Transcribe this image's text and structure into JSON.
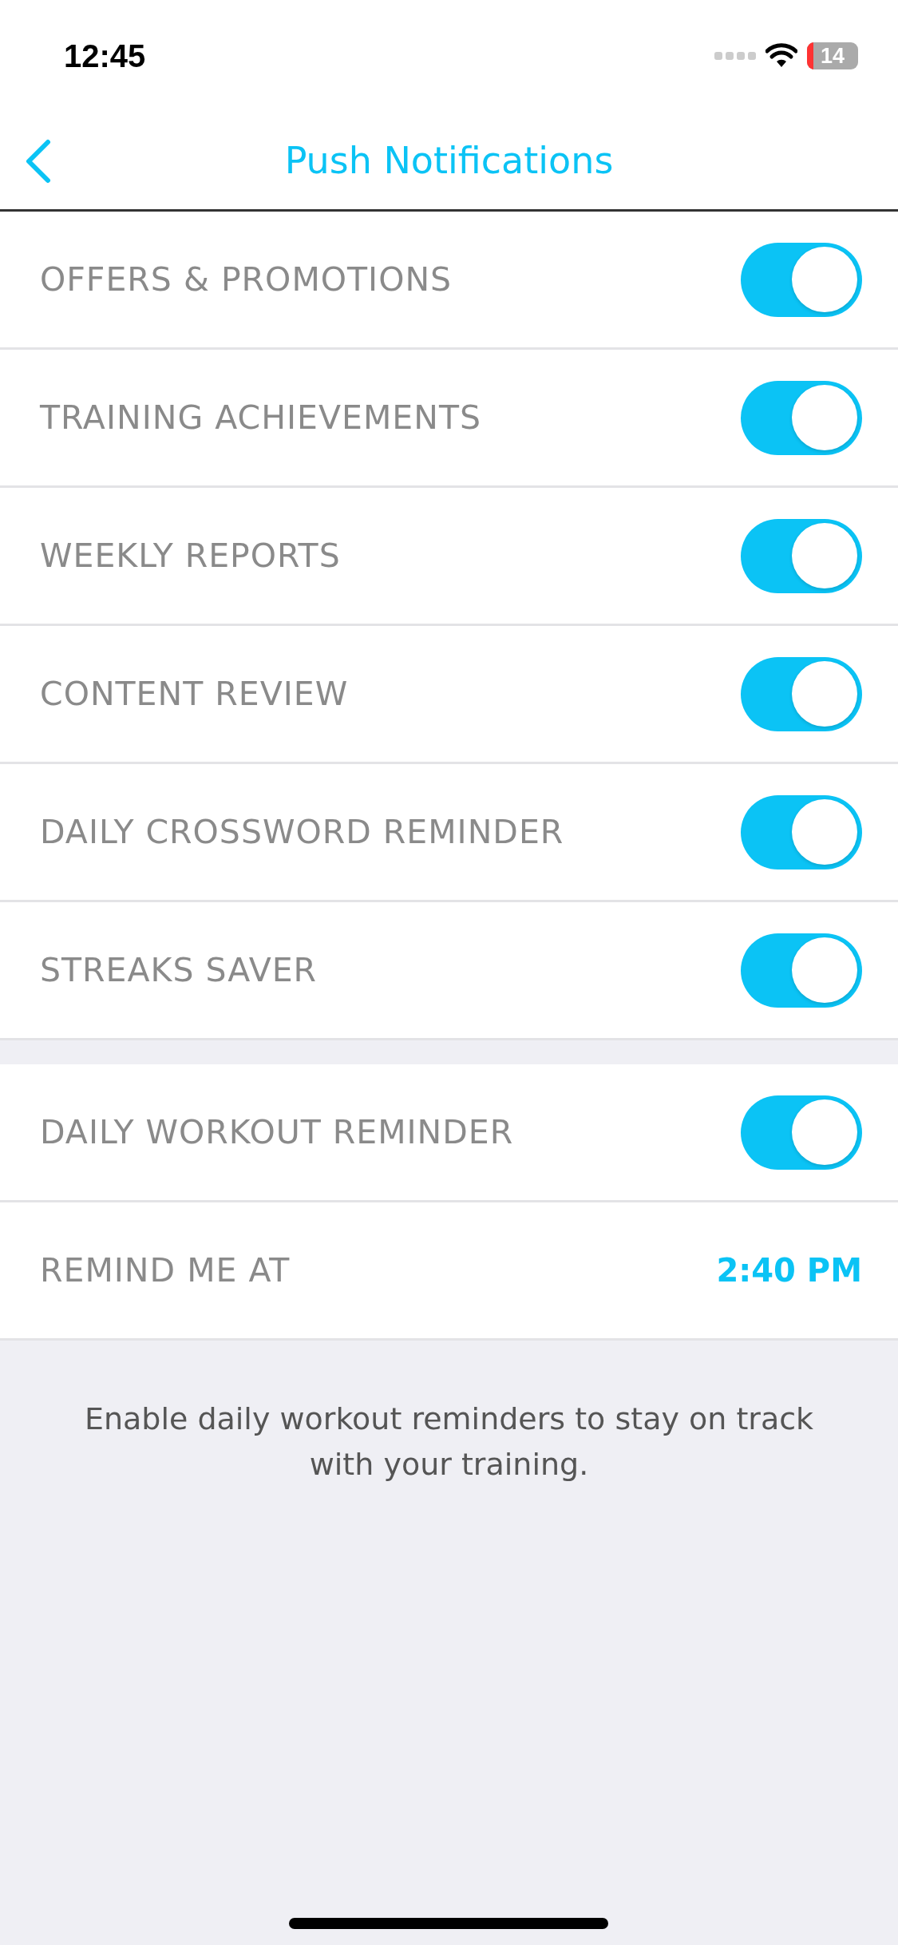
{
  "status_bar": {
    "time": "12:45",
    "battery": "14"
  },
  "header": {
    "title": "Push Notifications"
  },
  "sections": [
    {
      "rows": [
        {
          "kind": "toggle",
          "label": "OFFERS & PROMOTIONS",
          "on": true
        },
        {
          "kind": "toggle",
          "label": "TRAINING ACHIEVEMENTS",
          "on": true
        },
        {
          "kind": "toggle",
          "label": "WEEKLY REPORTS",
          "on": true
        },
        {
          "kind": "toggle",
          "label": "CONTENT REVIEW",
          "on": true
        },
        {
          "kind": "toggle",
          "label": "DAILY CROSSWORD REMINDER",
          "on": true
        },
        {
          "kind": "toggle",
          "label": "STREAKS SAVER",
          "on": true
        }
      ]
    },
    {
      "rows": [
        {
          "kind": "toggle",
          "label": "DAILY WORKOUT REMINDER",
          "on": true
        },
        {
          "kind": "value",
          "label": "REMIND ME AT",
          "value": "2:40 PM"
        }
      ]
    }
  ],
  "footer_note": "Enable daily workout reminders to stay on track with your training."
}
